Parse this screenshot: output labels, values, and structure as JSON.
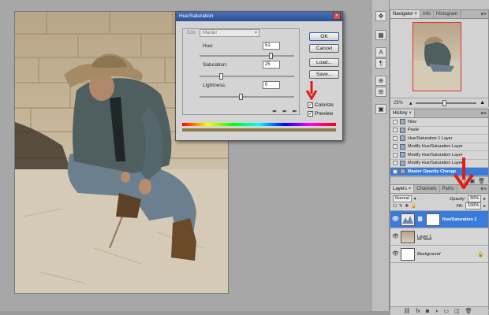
{
  "dialog": {
    "title": "Hue/Saturation",
    "close_icon": "close-icon",
    "edit_label": "Edit:",
    "edit_value": "Master",
    "hue_label": "Hue:",
    "hue_value": "51",
    "saturation_label": "Saturation:",
    "saturation_value": "25",
    "lightness_label": "Lightness:",
    "lightness_value": "0",
    "ok_label": "OK",
    "cancel_label": "Cancel",
    "load_label": "Load...",
    "save_label": "Save...",
    "colorize_label": "Colorize",
    "preview_label": "Preview",
    "colorize_checked": true,
    "preview_checked": true
  },
  "navigator": {
    "tabs": [
      "Navigator ×",
      "Info",
      "Histogram"
    ],
    "zoom": "25%"
  },
  "history": {
    "tabs": [
      "History ×"
    ],
    "items": [
      "New",
      "Paste",
      "Hue/Saturation 1 Layer",
      "Modify Hue/Saturation Layer",
      "Modify Hue/Saturation Layer",
      "Modify Hue/Saturation Layer",
      "Master Opacity Change"
    ],
    "selected_index": 6
  },
  "layers": {
    "tabs": [
      "Layers ×",
      "Channels",
      "Paths"
    ],
    "blend_mode": "Normal",
    "opacity_label": "Opacity:",
    "opacity_value": "50%",
    "fill_label": "Fill:",
    "fill_value": "100%",
    "items": [
      {
        "name": "Hue/Saturation 1",
        "selected": true
      },
      {
        "name": "Layer 1",
        "selected": false
      },
      {
        "name": "Background",
        "selected": false
      }
    ]
  },
  "colors": {
    "accent": "#3a7ad8",
    "annotation": "#e41b12"
  }
}
